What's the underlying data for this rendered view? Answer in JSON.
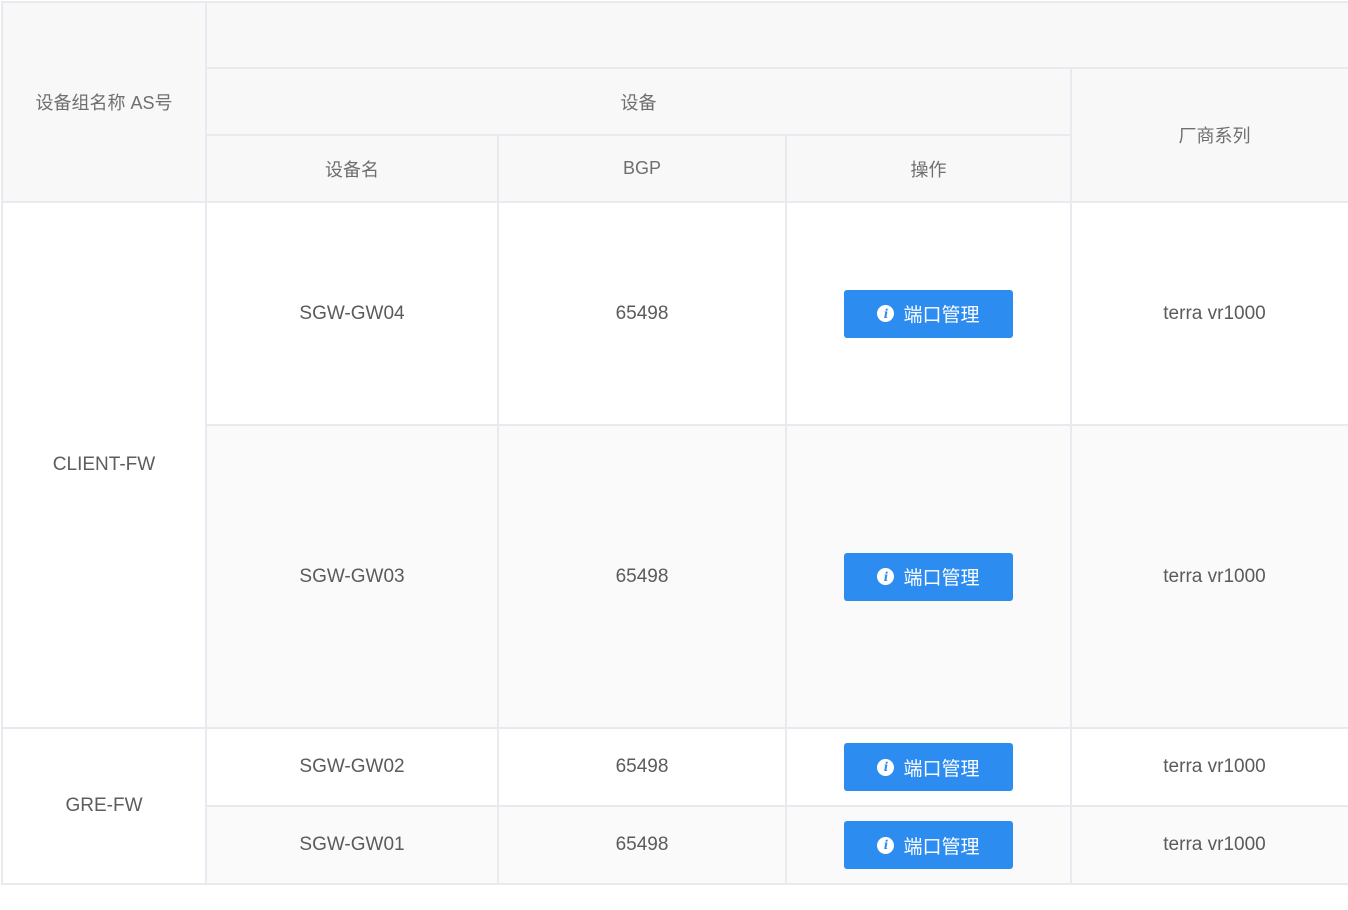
{
  "header": {
    "group_col": "设备组名称 AS号",
    "device_group": "设备",
    "device_name": "设备名",
    "bgp": "BGP",
    "operation": "操作",
    "vendor_series": "厂商系列"
  },
  "groups": [
    {
      "name": "CLIENT-FW"
    },
    {
      "name": "GRE-FW"
    }
  ],
  "rows": [
    {
      "device": "SGW-GW04",
      "bgp": "65498",
      "action": "端口管理",
      "vendor": "terra vr1000"
    },
    {
      "device": "SGW-GW03",
      "bgp": "65498",
      "action": "端口管理",
      "vendor": "terra vr1000"
    },
    {
      "device": "SGW-GW02",
      "bgp": "65498",
      "action": "端口管理",
      "vendor": "terra vr1000"
    },
    {
      "device": "SGW-GW01",
      "bgp": "65498",
      "action": "端口管理",
      "vendor": "terra vr1000"
    }
  ],
  "icons": {
    "action_button": "info-icon"
  },
  "colors": {
    "primary": "#2d8cf0",
    "header_bg": "#f8f8f9",
    "border": "#e7ebf0"
  }
}
